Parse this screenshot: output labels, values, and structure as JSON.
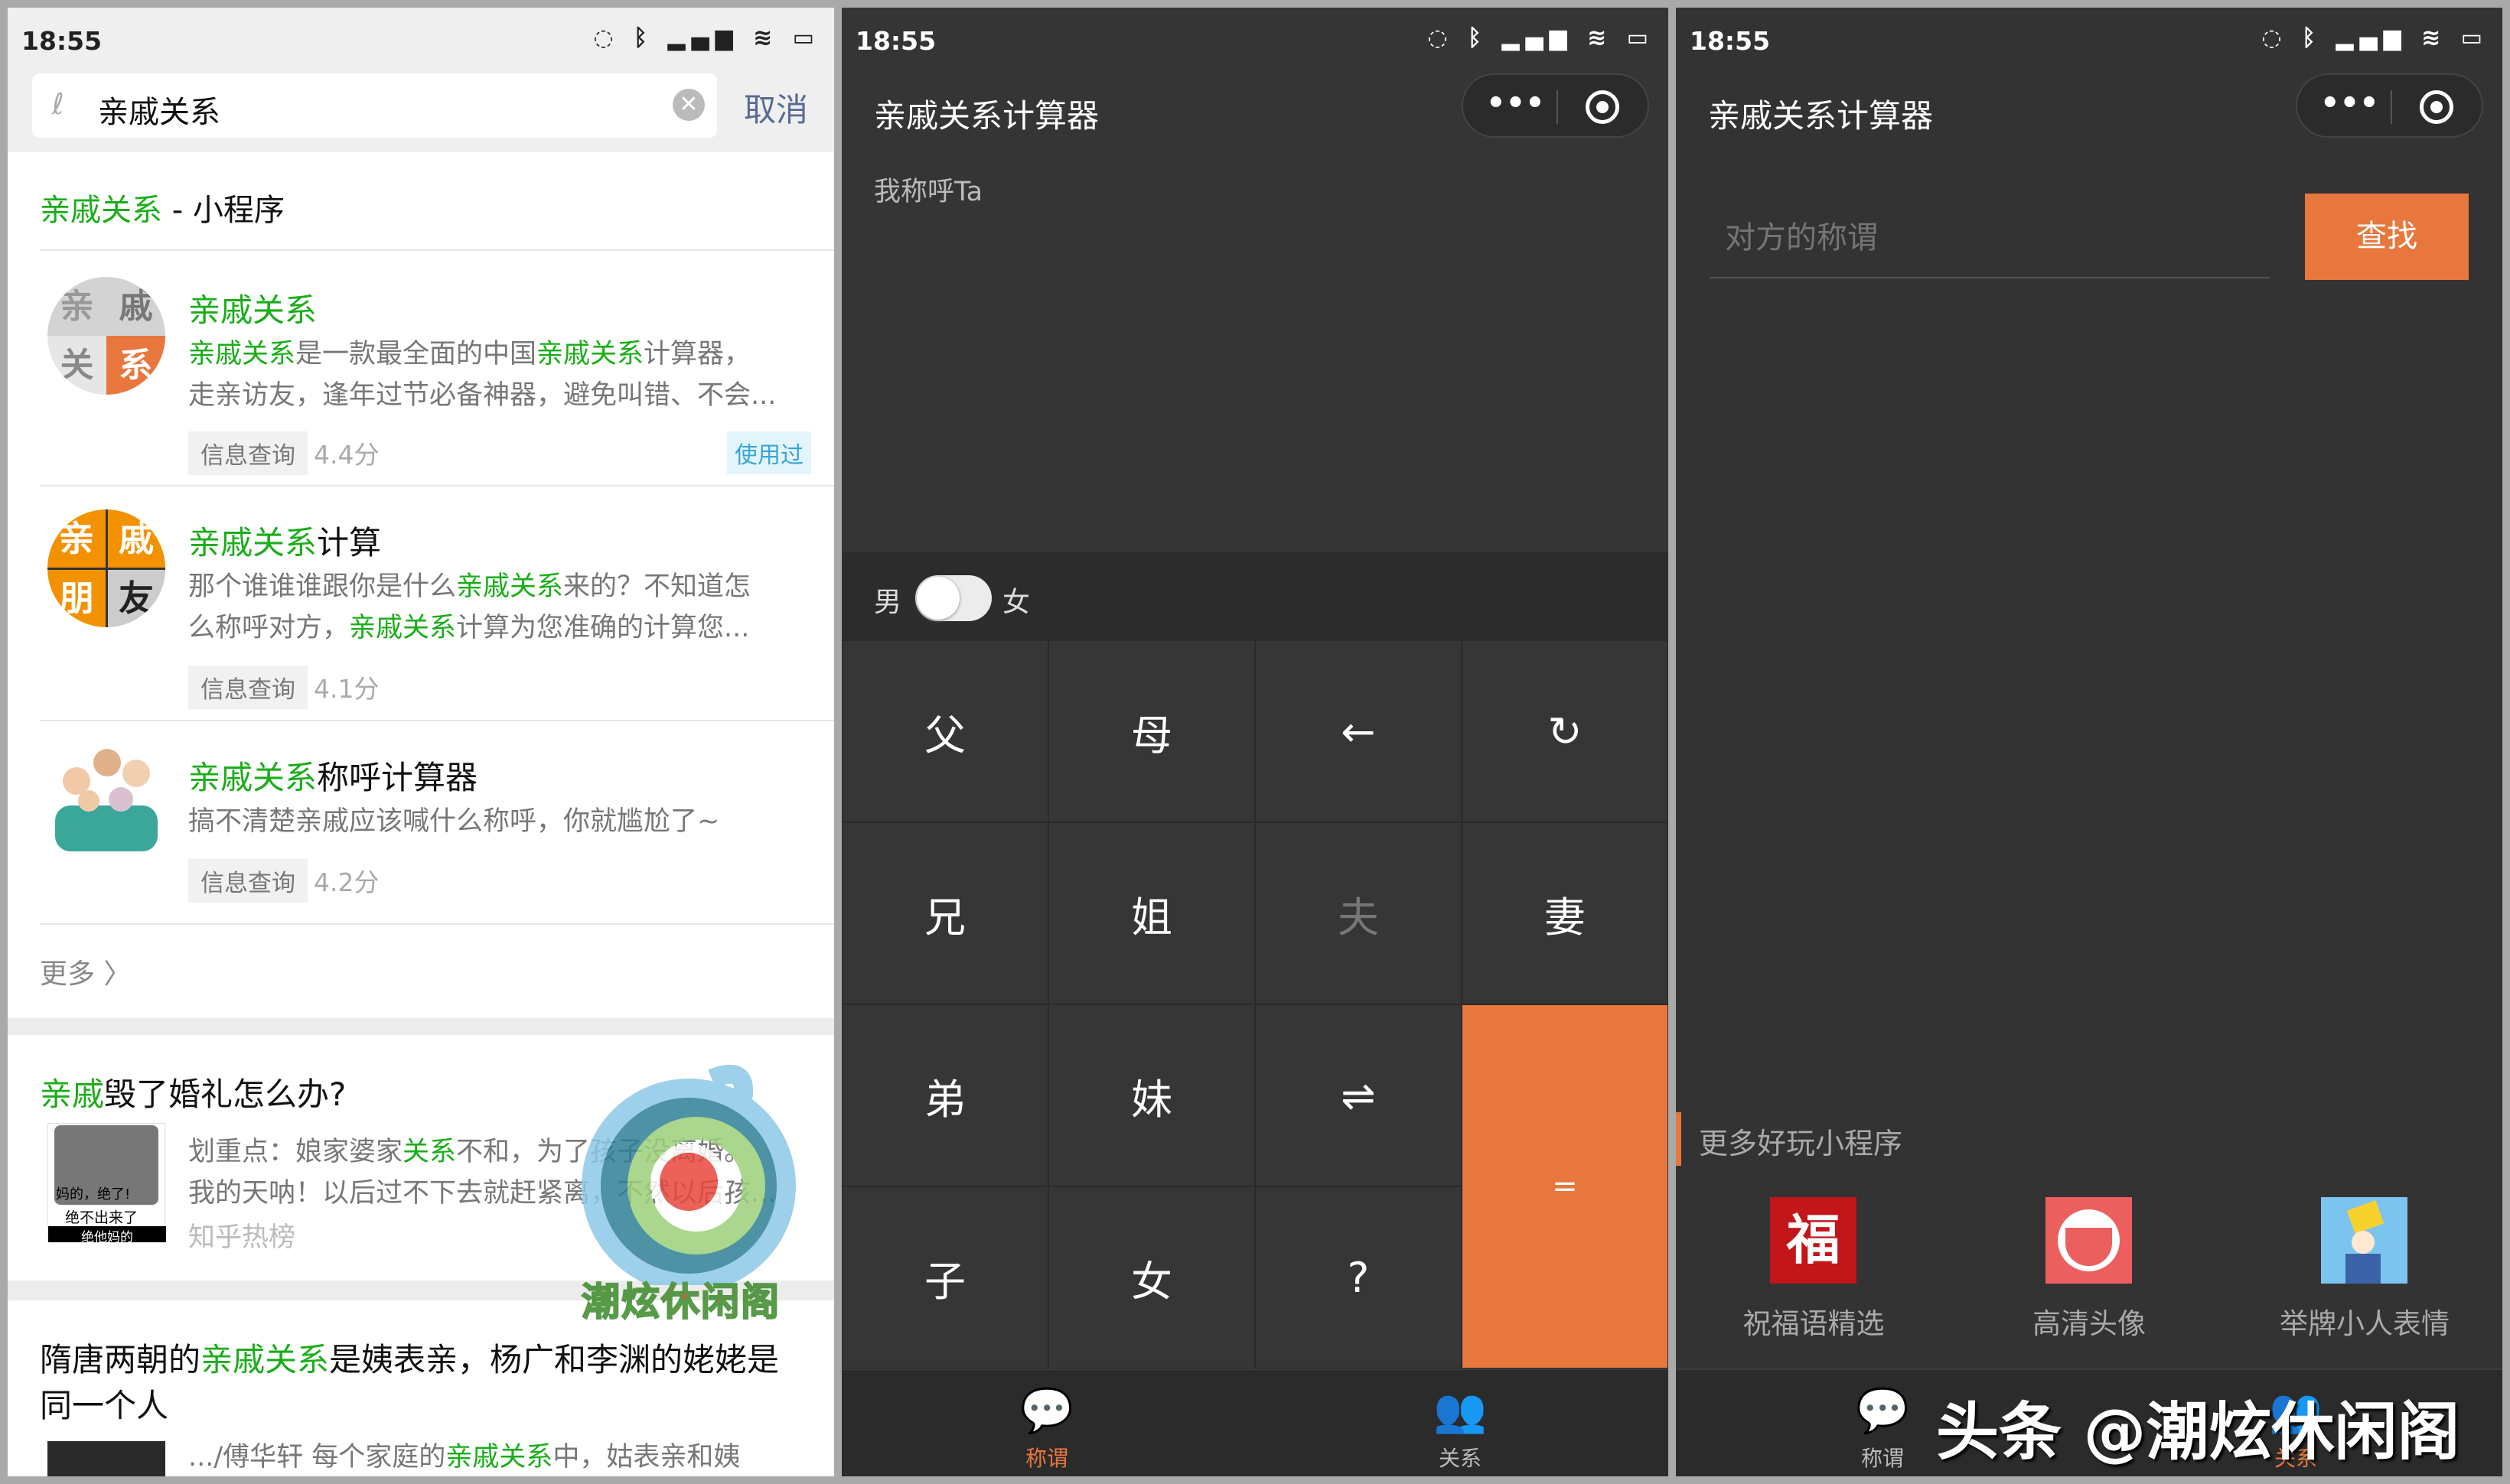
{
  "status": {
    "time": "18:55",
    "icons": [
      "nfc-icon",
      "bluetooth-icon",
      "signal-icon",
      "wifi-icon",
      "battery-icon"
    ]
  },
  "search_screen": {
    "query": "亲戚关系",
    "cancel": "取消",
    "section_hl": "亲戚关系",
    "section_rest": " - 小程序",
    "results": [
      {
        "title_hl": "亲戚关系",
        "title_rest": "",
        "desc1_parts": [
          "亲戚关系",
          "是一款最全面的中国",
          "亲戚关系",
          "计算器，"
        ],
        "desc2": "走亲访友，逢年过节必备神器，避免叫错、不会...",
        "tag": "信息查询",
        "score": "4.4分",
        "badge": "使用过",
        "icon_chars": [
          "亲",
          "戚",
          "关",
          "系"
        ]
      },
      {
        "title_hl": "亲戚关系",
        "title_rest": "计算",
        "desc1_parts": [
          "那个谁谁谁跟你是什么",
          "亲戚关系",
          "来的？不知道怎"
        ],
        "desc2_parts": [
          "么称呼对方，",
          "亲戚关系",
          "计算为您准确的计算您..."
        ],
        "tag": "信息查询",
        "score": "4.1分",
        "icon_chars": [
          "亲",
          "戚",
          "朋",
          "友"
        ]
      },
      {
        "title_hl": "亲戚关系",
        "title_rest": "称呼计算器",
        "desc1": "搞不清楚亲戚应该喊什么称呼，你就尴尬了~",
        "tag": "信息查询",
        "score": "4.2分"
      }
    ],
    "more": "更多",
    "article1": {
      "title_hl": "亲戚",
      "title_rest": "毁了婚礼怎么办?",
      "line1_parts": [
        "划重点：娘家婆家",
        "关系",
        "不和，为了孩子没离婚。"
      ],
      "line2": "我的天呐！以后过不下去就赶紧离，不然以后孩...",
      "source": "知乎热榜",
      "thumb_text": [
        "妈的，绝了!",
        "绝不出来了",
        "绝他妈的"
      ]
    },
    "article2": {
      "title_parts": [
        "隋唐两朝的",
        "亲戚关系",
        "是姨表亲，杨广和李渊的姥姥是"
      ],
      "title_line2": "同一个人",
      "line1_parts": [
        ".../傅华轩 每个家庭的",
        "亲戚关系",
        "中，姑表亲和姨"
      ]
    },
    "watermark_logo": "潮炫休闲阁"
  },
  "calc_screen": {
    "title": "亲戚关系计算器",
    "prompt": "我称呼Ta",
    "male": "男",
    "female": "女",
    "gender_toggle_on": false,
    "keys": [
      "父",
      "母",
      "←",
      "↻",
      "兄",
      "姐",
      "夫",
      "妻",
      "弟",
      "妹",
      "⇌",
      "=",
      "子",
      "女",
      "?"
    ],
    "disabled_keys": [
      "夫"
    ]
  },
  "find_screen": {
    "title": "亲戚关系计算器",
    "placeholder": "对方的称谓",
    "button": "查找",
    "more_title": "更多好玩小程序",
    "minis": [
      {
        "label": "祝福语精选",
        "icon": "fu-icon"
      },
      {
        "label": "高清头像",
        "icon": "avatar-face-icon"
      },
      {
        "label": "举牌小人表情",
        "icon": "sign-holder-icon"
      }
    ]
  },
  "tabs": [
    {
      "label": "称谓",
      "icon": "chat-icon"
    },
    {
      "label": "关系",
      "icon": "people-icon"
    }
  ],
  "watermark": "头条 @潮炫休闲阁",
  "colors": {
    "green": "#1aad19",
    "orange": "#e8773d",
    "dark": "#333333"
  }
}
